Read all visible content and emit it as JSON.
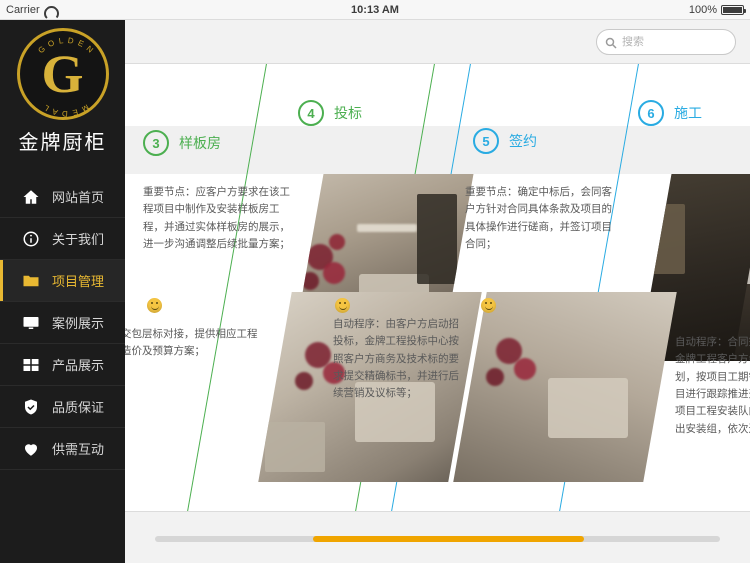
{
  "status_bar": {
    "carrier": "Carrier",
    "wifi_icon": "wifi-icon",
    "time": "10:13 AM",
    "battery_percent": "100%",
    "battery_icon": "battery-icon"
  },
  "sidebar": {
    "logo": {
      "letter": "G",
      "ring_text_top": "GOLDEN",
      "ring_text_bottom": "MEDAL",
      "brand_name": "金牌厨柜"
    },
    "items": [
      {
        "label": "网站首页",
        "icon": "home-icon",
        "active": false
      },
      {
        "label": "关于我们",
        "icon": "info-icon",
        "active": false
      },
      {
        "label": "项目管理",
        "icon": "folder-icon",
        "active": true
      },
      {
        "label": "案例展示",
        "icon": "monitor-icon",
        "active": false
      },
      {
        "label": "产品展示",
        "icon": "grid-icon",
        "active": false
      },
      {
        "label": "品质保证",
        "icon": "shield-check-icon",
        "active": false
      },
      {
        "label": "供需互动",
        "icon": "heart-icon",
        "active": false
      }
    ]
  },
  "topbar": {
    "search": {
      "icon": "search-icon",
      "value": "",
      "placeholder": "搜索"
    }
  },
  "content": {
    "steps": [
      {
        "number": "3",
        "label": "样板房",
        "color": "#4caf50"
      },
      {
        "number": "4",
        "label": "投标",
        "color": "#4caf50"
      },
      {
        "number": "5",
        "label": "签约",
        "color": "#29abe2"
      },
      {
        "number": "6",
        "label": "施工",
        "color": "#29abe2"
      }
    ],
    "texts": {
      "step3_top": "重要节点：应客户方要求在该工程项目中制作及安装样板房工程，并通过实体样板房的展示，进一步沟通调整后续批量方案；",
      "step3_bottom": "交包层标对接，提供相应工程造价及预算方案；",
      "step4_bottom": "自动程序：由客户方启动招投标，金牌工程投标中心按照客户方商务及技术标的要求提交精确标书，并进行后续营销及议标等；",
      "step5_top": "重要节点：确定中标后，会同客户方针对合同具体条款及项目的具体操作进行磋商，并签订项目合同；",
      "step6_bottom": "自动程序：合同签订后，金牌工程客户方会同排计划，按项目工期需求对项目进行跟踪推进开市，按项目工程安装队向项目派出安装组，依次进行……"
    }
  },
  "bottom_bar": {
    "scroll_position_percent": 52
  }
}
